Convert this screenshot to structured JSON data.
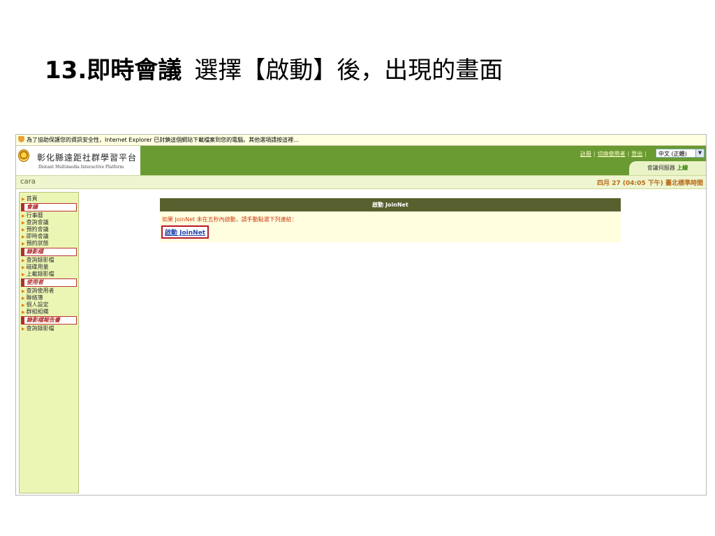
{
  "slide": {
    "title_num": "13.即時會議",
    "title_rest": "選擇【啟動】後，出現的畫面"
  },
  "infobar": {
    "text": "為了協助保護您的資訊安全性，Internet Explorer 已封鎖這個網站下載檔案到您的電腦。其他選項請按這裡..."
  },
  "header": {
    "logo_title": "彰化縣遠距社群學習平台",
    "logo_subtitle": "Distant Multimedia Interactive Platform",
    "links": [
      "註冊",
      "切換使用者",
      "登出"
    ],
    "language_selected": "中文 (正體)",
    "server_label": "會議伺服器",
    "server_status": "上線",
    "brand_green": "#6a9a32"
  },
  "userbar": {
    "username": "cara",
    "datetime": "四月 27 (04:05 下午) 臺北標準時間"
  },
  "sidebar": {
    "home": "首頁",
    "section_meeting": "會議",
    "meeting_items": [
      "行事曆",
      "查詢會議",
      "預約會議",
      "即時會議",
      "預約狀態"
    ],
    "section_recording": "錄影檔",
    "recording_items": [
      "查詢錄影檔",
      "磁碟用量",
      "上載錄影檔"
    ],
    "section_user": "使用者",
    "user_items": [
      "查詢使用者",
      "聯絡簿",
      "個人設定",
      "群組組織"
    ],
    "section_report": "錄影檔報告書",
    "report_items": [
      "查詢錄影檔"
    ]
  },
  "main": {
    "panel_title": "啟動 JoinNet",
    "message": "如果 JoinNet 未在五秒內啟動，請手動點選下列連結：",
    "launch_link": "啟動 JoinNet",
    "highlight_color": "#b8182a"
  }
}
